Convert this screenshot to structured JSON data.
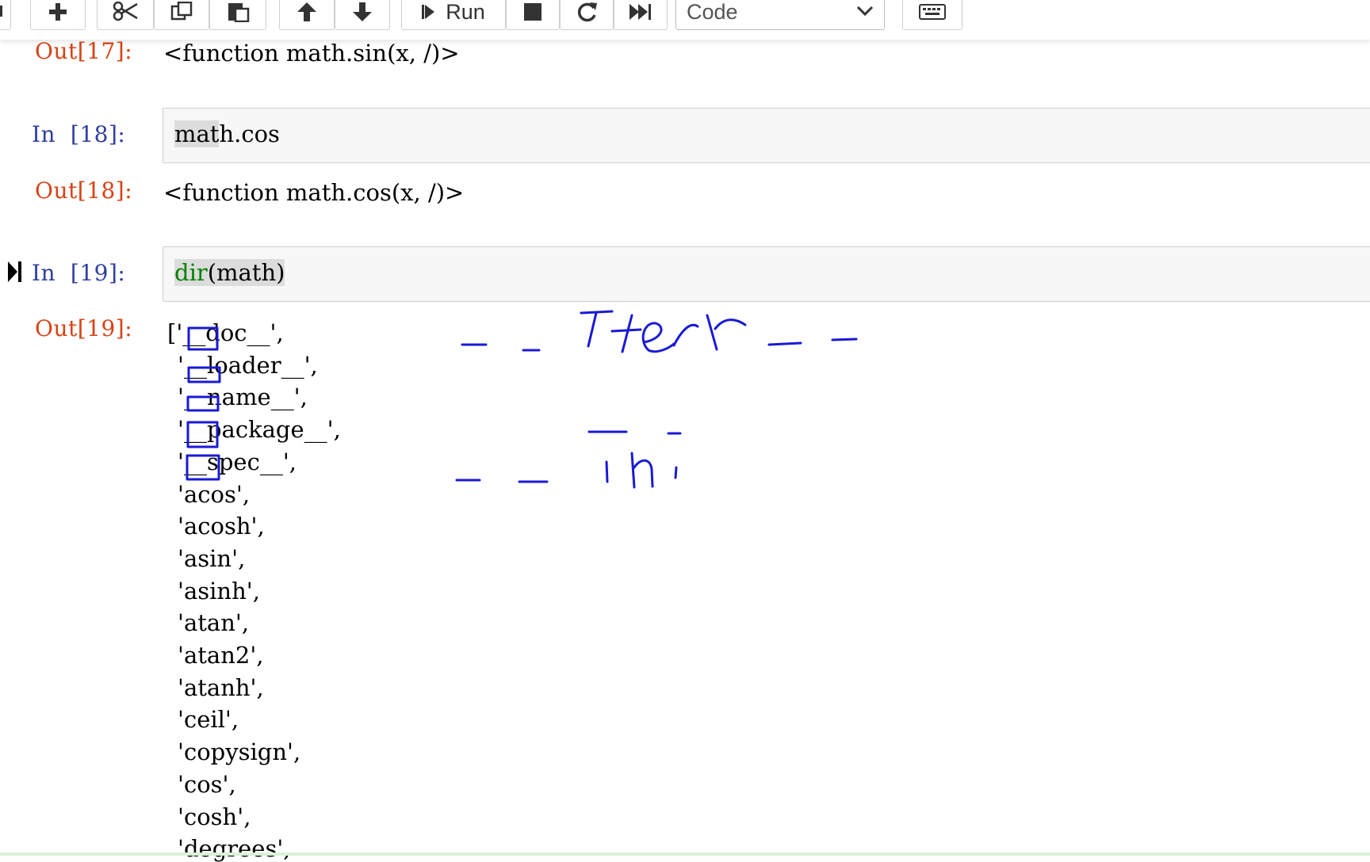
{
  "toolbar": {
    "run_label": "Run",
    "cell_type": "Code",
    "icons": [
      "save-icon",
      "add-icon",
      "cut-icon",
      "copy-icon",
      "paste-icon",
      "move-up-icon",
      "move-down-icon",
      "run-icon",
      "stop-icon",
      "restart-icon",
      "fast-forward-icon",
      "chevron-down-icon",
      "keyboard-icon"
    ]
  },
  "cells": [
    {
      "out_prompt": "Out[17]:",
      "output": "<function math.sin(x, /)>"
    },
    {
      "in_prompt": "In  [18]:",
      "code_hl": "mat",
      "code_rest": "h.cos",
      "out_prompt": "Out[18]:",
      "output": "<function math.cos(x, /)>"
    },
    {
      "in_prompt": "In  [19]:",
      "code_fn": "dir",
      "code_args": "(math)",
      "out_prompt": "Out[19]:",
      "output_list": [
        "['__doc__',",
        "'__loader__',",
        "'__name__',",
        "'__package__',",
        "'__spec__',",
        "'acos',",
        "'acosh',",
        "'asin',",
        "'asinh',",
        "'atan',",
        "'atan2',",
        "'atanh',",
        "'ceil',",
        "'copysign',",
        "'cos',",
        "'cosh',",
        "'degrees',"
      ]
    }
  ],
  "colors": {
    "in_prompt": "#303f9f",
    "out_prompt": "#d84315",
    "ink": "#1a1ad6"
  }
}
